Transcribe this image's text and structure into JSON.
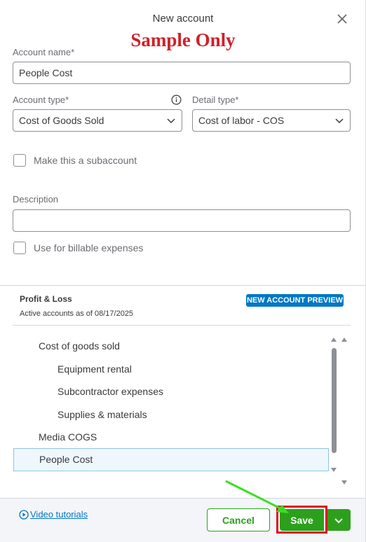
{
  "dialog": {
    "title": "New account",
    "watermark": "Sample Only"
  },
  "form": {
    "account_name": {
      "label": "Account name*",
      "value": "People Cost"
    },
    "account_type": {
      "label": "Account type*",
      "value": "Cost of Goods Sold"
    },
    "detail_type": {
      "label": "Detail type*",
      "value": "Cost of labor - COS"
    },
    "subaccount": {
      "label": "Make this a subaccount",
      "checked": false
    },
    "description": {
      "label": "Description",
      "value": ""
    },
    "billable": {
      "label": "Use for billable expenses",
      "checked": false
    }
  },
  "preview": {
    "title": "Profit & Loss",
    "subtitle": "Active accounts as of 08/17/2025",
    "badge": "NEW ACCOUNT PREVIEW",
    "items": [
      {
        "label": "Cost of goods sold",
        "level": 1
      },
      {
        "label": "Equipment rental",
        "level": 2
      },
      {
        "label": "Subcontractor expenses",
        "level": 2
      },
      {
        "label": "Supplies & materials",
        "level": 2
      },
      {
        "label": "Media COGS",
        "level": 1
      },
      {
        "label": "People Cost",
        "level": 1,
        "selected": true
      }
    ]
  },
  "footer": {
    "video_link": "Video tutorials",
    "cancel_label": "Cancel",
    "save_label": "Save"
  },
  "colors": {
    "accent_green": "#2ca01c",
    "link_blue": "#0077c5",
    "highlight_red": "#d9151f",
    "watermark_red": "#d0202a"
  },
  "icons": [
    "close-icon",
    "info-icon",
    "chevron-down-icon",
    "play-circle-icon"
  ]
}
